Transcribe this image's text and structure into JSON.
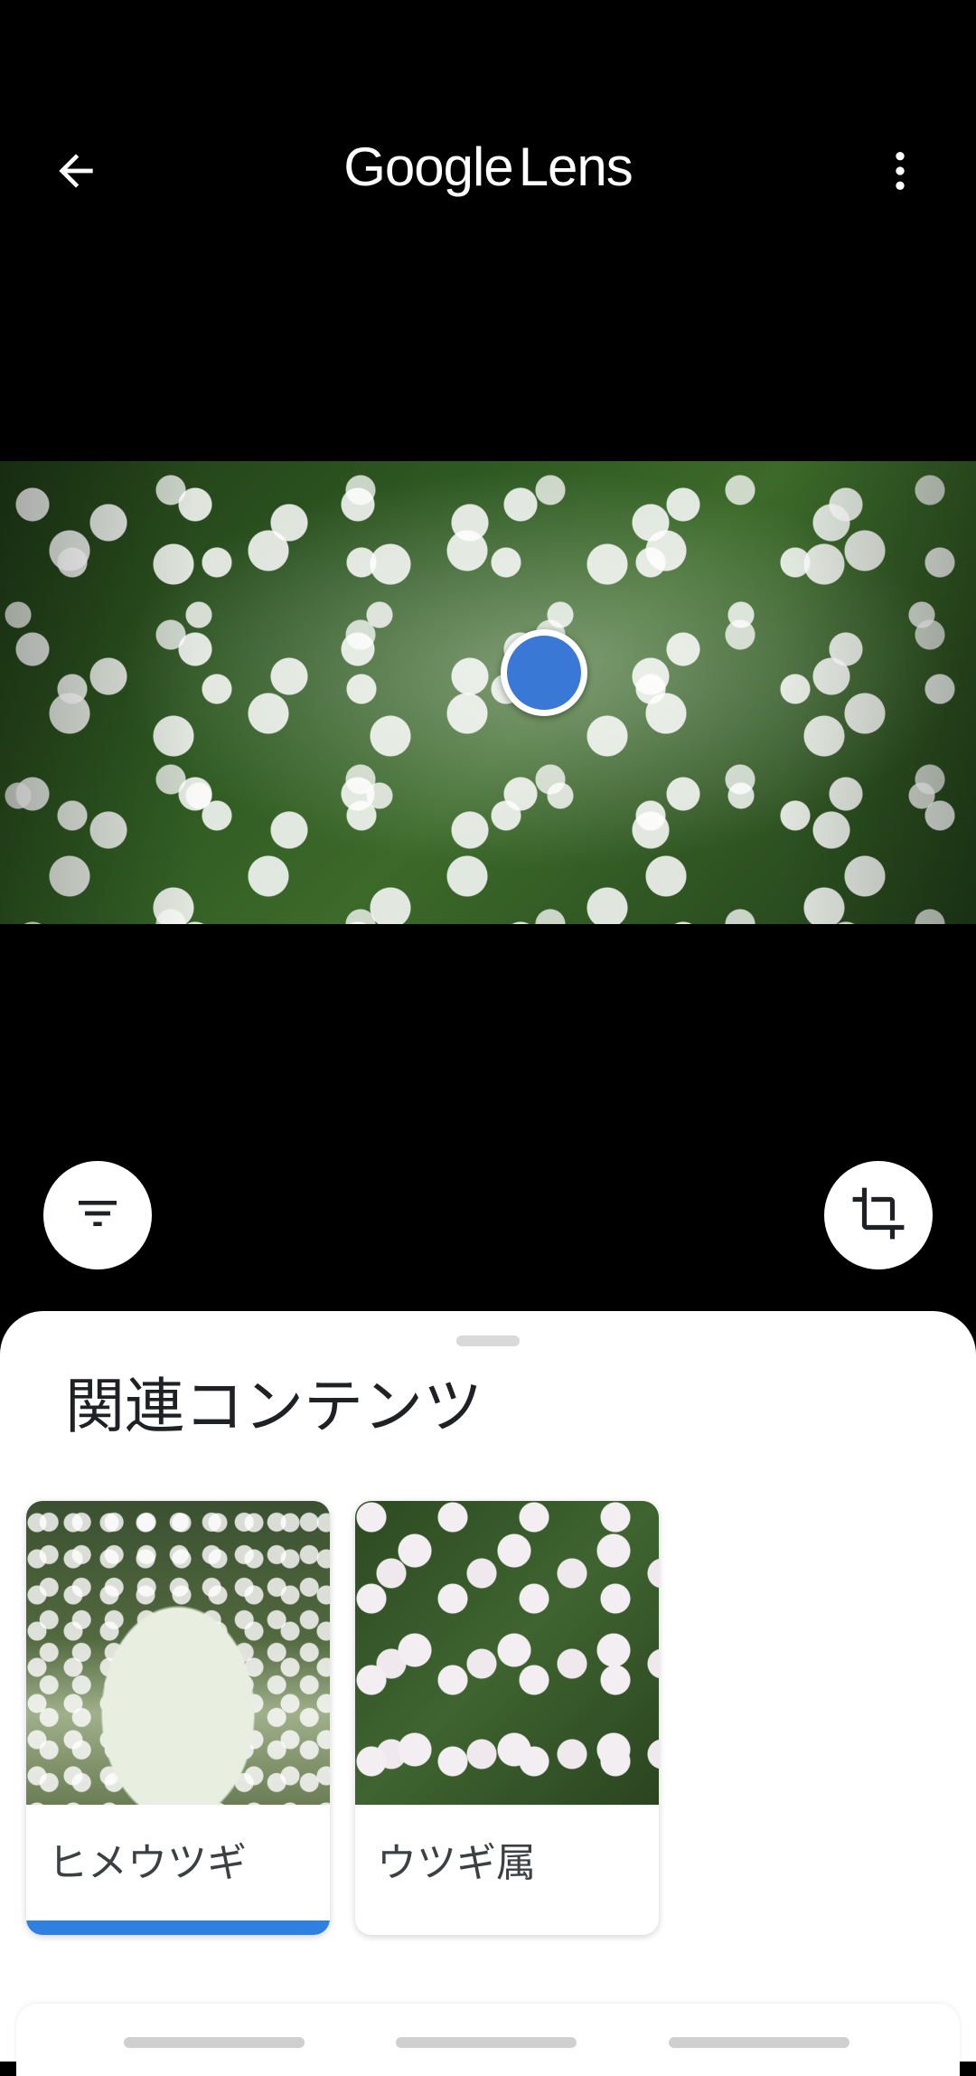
{
  "header": {
    "title_google": "Google",
    "title_lens": "Lens",
    "back_icon": "arrow-back-icon",
    "more_icon": "more-vert-icon"
  },
  "image_view": {
    "description_icon": "focus-dot-icon",
    "focus_color": "#3a78d6"
  },
  "controls": {
    "filter_icon": "filter-icon",
    "crop_icon": "crop-icon"
  },
  "results_sheet": {
    "title": "関連コンテンツ",
    "cards": [
      {
        "label": "ヒメウツギ",
        "selected": true
      },
      {
        "label": "ウツギ属",
        "selected": false
      }
    ],
    "accent": "#2f80e0"
  }
}
